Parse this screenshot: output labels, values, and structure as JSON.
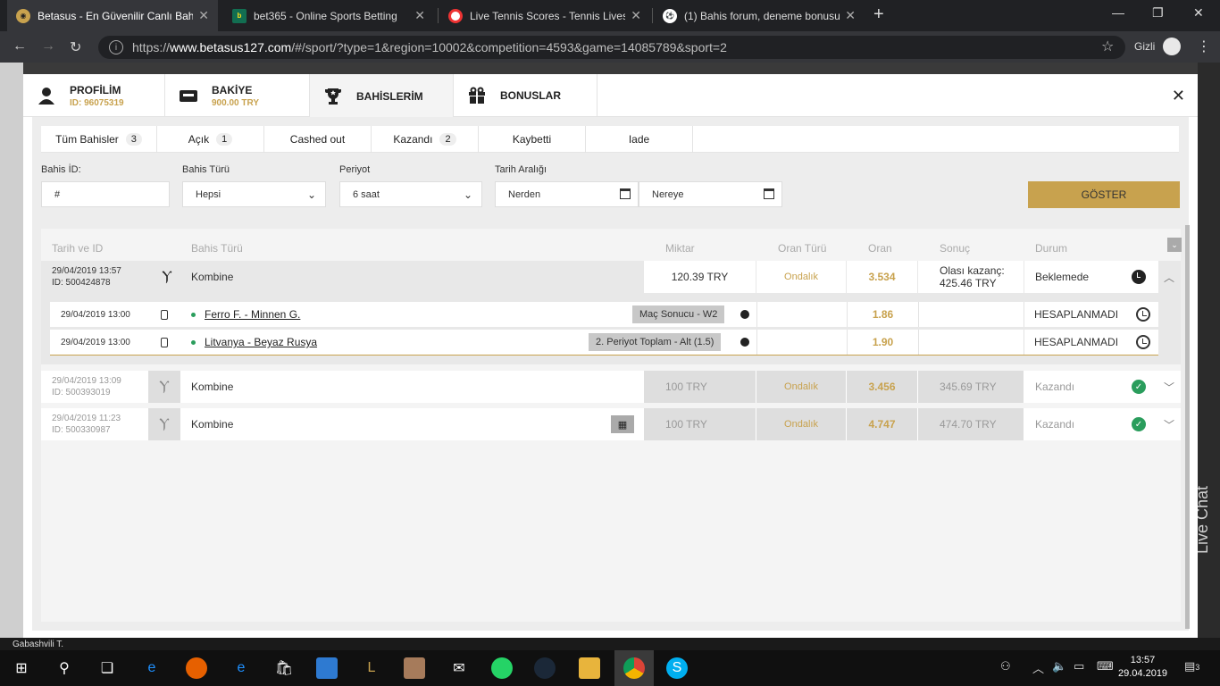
{
  "browser": {
    "tabs": [
      {
        "title": "Betasus - En Güvenilir Canlı Bahis",
        "favicon": "betasus-icon",
        "active": true
      },
      {
        "title": "bet365 - Online Sports Betting",
        "favicon": "bet365-icon",
        "active": false
      },
      {
        "title": "Live Tennis Scores - Tennis Livesc",
        "favicon": "livescore-icon",
        "active": false
      },
      {
        "title": "(1) Bahis forum, deneme bonusu",
        "favicon": "ball-icon",
        "active": false
      }
    ],
    "url_scheme": "https://",
    "url_host": "www.betasus127.com",
    "url_path": "/#/sport/?type=1&region=10002&competition=4593&game=14085789&sport=2",
    "incognito_label": "Gizli"
  },
  "modal": {
    "tabs": [
      {
        "label": "PROFİLİM",
        "sub": "ID: 96075319",
        "icon": "user-icon"
      },
      {
        "label": "BAKİYE",
        "sub": "900.00 TRY",
        "icon": "wallet-icon"
      },
      {
        "label": "BAHİSLERİM",
        "sub": "",
        "icon": "trophy-icon"
      },
      {
        "label": "BONUSLAR",
        "sub": "",
        "icon": "gift-icon"
      }
    ],
    "filter_tabs": [
      {
        "label": "Tüm Bahisler",
        "count": "3"
      },
      {
        "label": "Açık",
        "count": "1"
      },
      {
        "label": "Cashed out",
        "count": ""
      },
      {
        "label": "Kazandı",
        "count": "2"
      },
      {
        "label": "Kaybetti",
        "count": ""
      },
      {
        "label": "Iade",
        "count": ""
      }
    ],
    "filters": {
      "bet_id_label": "Bahis İD:",
      "bet_id_value": "#",
      "bet_type_label": "Bahis Türü",
      "bet_type_value": "Hepsi",
      "period_label": "Periyot",
      "period_value": "6 saat",
      "date_range_label": "Tarih Aralığı",
      "from_placeholder": "Nerden",
      "to_placeholder": "Nereye",
      "show_button": "GÖSTER"
    },
    "columns": {
      "date_id": "Tarih ve ID",
      "bet_type": "Bahis Türü",
      "amount": "Miktar",
      "odds_type": "Oran Türü",
      "odds": "Oran",
      "result": "Sonuç",
      "status": "Durum"
    },
    "bets": [
      {
        "date": "29/04/2019 13:57",
        "id": "ID: 500424878",
        "type": "Kombine",
        "amount": "120.39  TRY",
        "odds_type": "Ondalık",
        "odds": "3.534",
        "result_label": "Olası kazanç:",
        "result_value": "425.46 TRY",
        "status": "Beklemede",
        "selections": [
          {
            "date": "29/04/2019 13:00",
            "match": "Ferro F. - Minnen G.",
            "market": "Maç Sonucu - W2",
            "odds": "1.86",
            "status": "HESAPLANMADI"
          },
          {
            "date": "29/04/2019 13:00",
            "match": "Litvanya - Beyaz Rusya",
            "market": "2. Periyot Toplam - Alt (1.5)",
            "odds": "1.90",
            "status": "HESAPLANMADI"
          }
        ]
      },
      {
        "date": "29/04/2019 13:09",
        "id": "ID: 500393019",
        "type": "Kombine",
        "amount": "100  TRY",
        "odds_type": "Ondalık",
        "odds": "3.456",
        "result_value": "345.69 TRY",
        "status": "Kazandı"
      },
      {
        "date": "29/04/2019 11:23",
        "id": "ID: 500330987",
        "type": "Kombine",
        "amount": "100  TRY",
        "odds_type": "Ondalık",
        "odds": "4.747",
        "result_value": "474.70 TRY",
        "status": "Kazandı"
      }
    ]
  },
  "background": {
    "bottom_text": "Gabashvili T.",
    "live_chat": "Live Chat"
  },
  "taskbar": {
    "time": "13:57",
    "date": "29.04.2019",
    "notifications": "3"
  },
  "colors": {
    "accent_gold": "#c8a24e",
    "win_green": "#2a9d5c",
    "chrome_dark": "#202124"
  }
}
